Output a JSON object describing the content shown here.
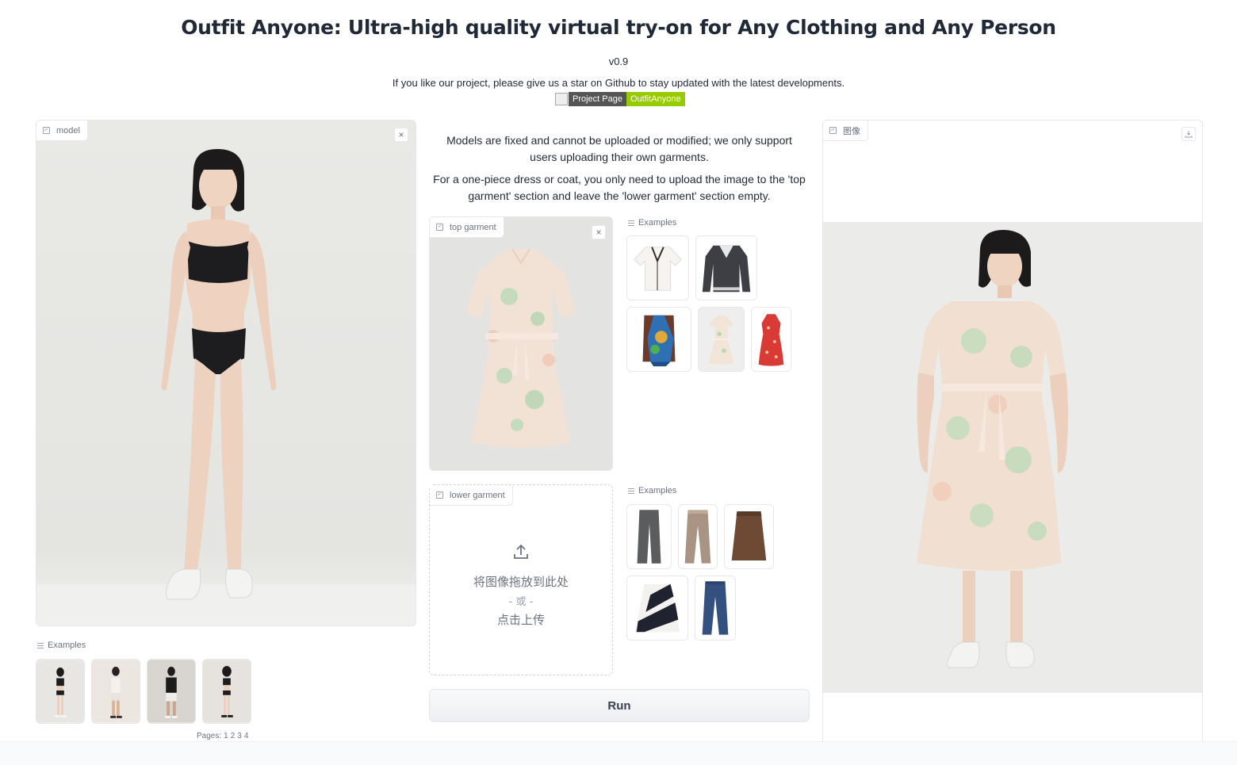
{
  "header": {
    "title": "Outfit Anyone: Ultra-high quality virtual try-on for Any Clothing and Any Person",
    "version": "v0.9",
    "subtitle": "If you like our project, please give us a star on Github to stay updated with the latest developments.",
    "badge_left": "Project Page",
    "badge_right": "OutfitAnyone"
  },
  "model_panel": {
    "label": "model",
    "close_symbol": "×",
    "examples_label": "Examples",
    "pages_label": "Pages:",
    "pages": [
      "1",
      "2",
      "3",
      "4"
    ]
  },
  "instructions": {
    "line1": "Models are fixed and cannot be uploaded or modified; we only support users uploading their own garments.",
    "line2": "For a one-piece dress or coat, you only need to upload the image to the 'top garment' section and leave the 'lower garment' section empty."
  },
  "top_garment": {
    "label": "top garment",
    "close_symbol": "×",
    "examples_label": "Examples"
  },
  "lower_garment": {
    "label": "lower garment",
    "upload_drop": "将图像拖放到此处",
    "upload_or": "- 或 -",
    "upload_click": "点击上传",
    "examples_label": "Examples"
  },
  "run_button": {
    "label": "Run"
  },
  "output_panel": {
    "label": "图像"
  },
  "colors": {
    "badge_dark": "#555555",
    "badge_green": "#97ca00",
    "panel_border": "#e5e7eb",
    "text_main": "#1f2937",
    "text_muted": "#6b7280"
  }
}
